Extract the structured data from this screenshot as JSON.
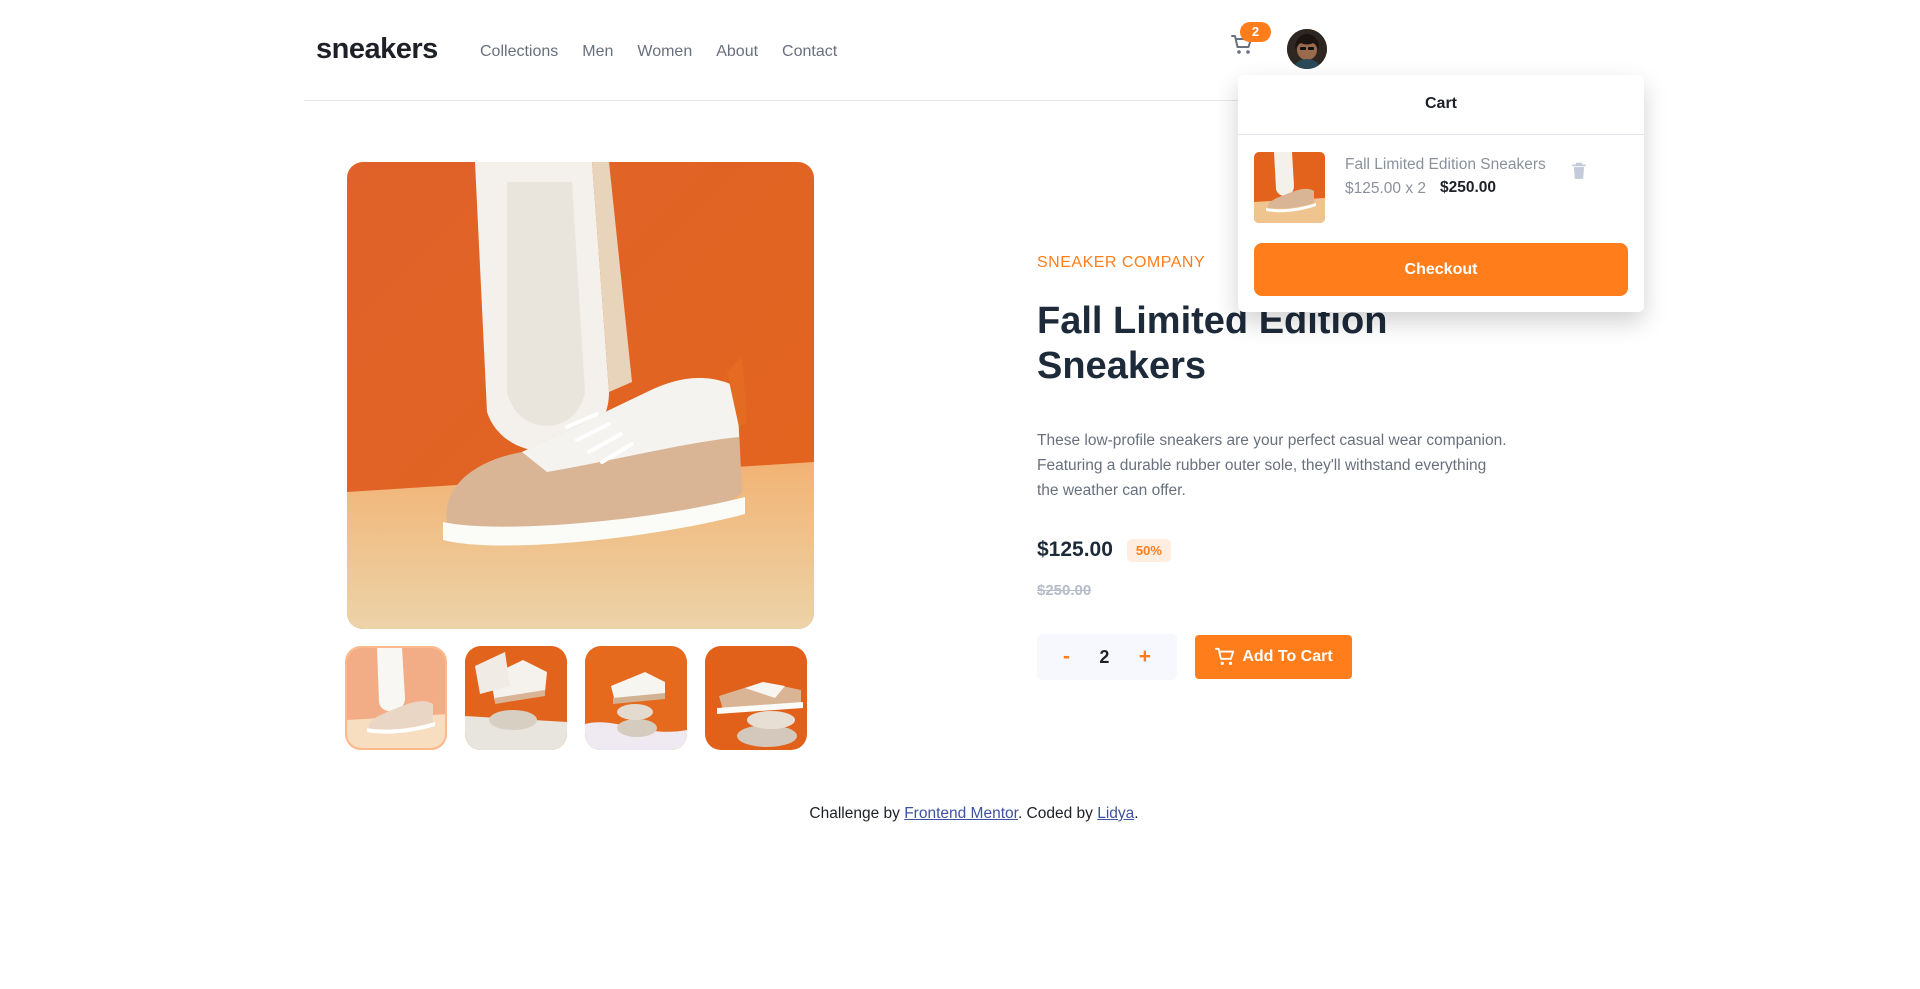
{
  "header": {
    "logo": "sneakers",
    "nav": [
      "Collections",
      "Men",
      "Women",
      "About",
      "Contact"
    ],
    "cart_count": "2"
  },
  "product": {
    "company": "SNEAKER COMPANY",
    "title_line1": "Fall Limited Edition",
    "title_line2": "Sneakers",
    "description": "These low-profile sneakers are your perfect casual wear companion. Featuring a durable rubber outer sole, they'll withstand everything the weather can offer.",
    "price": "$125.00",
    "discount": "50%",
    "old_price": "$250.00",
    "quantity": "2",
    "minus_label": "-",
    "plus_label": "+",
    "add_to_cart_label": "Add To Cart"
  },
  "cart": {
    "title": "Cart",
    "item_name": "Fall Limited Edition Sneakers",
    "item_line": "$125.00 x 2",
    "item_total": "$250.00",
    "checkout_label": "Checkout"
  },
  "footer": {
    "prefix": "Challenge by ",
    "link1": "Frontend Mentor",
    "middle": ". Coded by ",
    "link2": "Lidya",
    "suffix": "."
  },
  "colors": {
    "accent": "#ff7e1b",
    "dark": "#1d2026",
    "muted": "#69707d"
  },
  "icons": {
    "cart": "cart-icon",
    "trash": "trash-icon",
    "avatar": "user-avatar"
  }
}
